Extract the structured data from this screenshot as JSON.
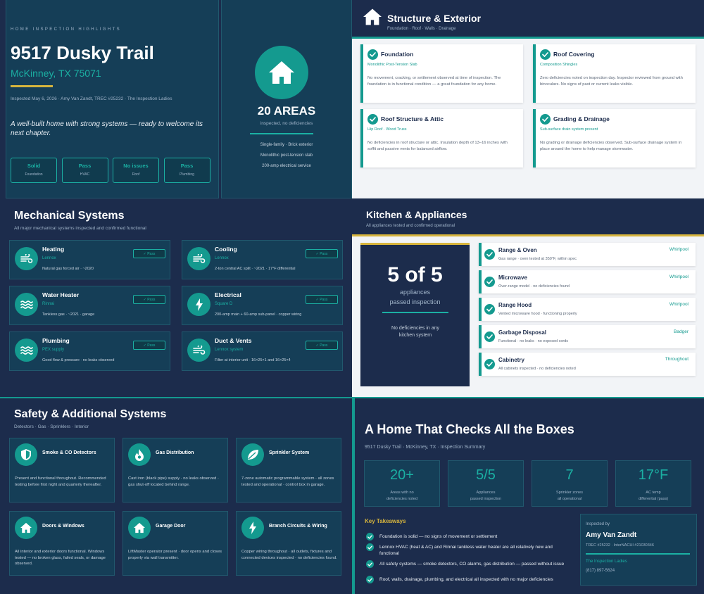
{
  "hero": {
    "eyebrow": "HOME INSPECTION HIGHLIGHTS",
    "address": "9517 Dusky Trail",
    "city": "McKinney, TX 75071",
    "meta": "Inspected May 6, 2026  ·  Amy Van Zandt, TREC #25232  ·  The Inspection Ladies",
    "tagline": "A well-built home with strong systems — ready to welcome its next chapter.",
    "stats": [
      {
        "value": "Solid",
        "label": "Foundation"
      },
      {
        "value": "Pass",
        "label": "HVAC"
      },
      {
        "value": "No issues",
        "label": "Roof"
      },
      {
        "value": "Pass",
        "label": "Plumbing"
      }
    ],
    "big_number": "20 AREAS",
    "big_sub": "inspected, no deficiencies",
    "facts": [
      "Single-family · Brick exterior",
      "Monolithic post-tension slab",
      "200-amp electrical service"
    ]
  },
  "structure": {
    "title": "Structure & Exterior",
    "subtitle": "Foundation · Roof · Walls · Drainage",
    "cards": [
      {
        "title": "Foundation",
        "sub": "Monolithic Post-Tension Slab",
        "body": "No movement, cracking, or settlement observed at time of inspection. The foundation is in functional condition — a great foundation for any home."
      },
      {
        "title": "Roof Covering",
        "sub": "Composition Shingles",
        "body": "Zero deficiencies noted on inspection day. Inspector reviewed from ground with binoculars. No signs of past or current leaks visible."
      },
      {
        "title": "Roof Structure & Attic",
        "sub": "Hip Roof · Wood Truss",
        "body": "No deficiencies in roof structure or attic. Insulation depth of 13–16 inches with soffit and passive vents for balanced airflow."
      },
      {
        "title": "Grading & Drainage",
        "sub": "Sub-surface drain system present",
        "body": "No grading or drainage deficiencies observed. Sub-surface drainage system in place around the home to help manage stormwater."
      }
    ]
  },
  "mechanical": {
    "title": "Mechanical Systems",
    "subtitle": "All major mechanical systems inspected and confirmed functional",
    "pass_label": "✓ Pass",
    "items": [
      {
        "title": "Heating",
        "brand": "Lennox",
        "desc": "Natural gas forced air · ~2020",
        "icon": "wind-icon"
      },
      {
        "title": "Cooling",
        "brand": "Lennox",
        "desc": "2-ton central AC split · ~2021 · 17°F differential",
        "icon": "wind-icon"
      },
      {
        "title": "Water Heater",
        "brand": "Rinnai",
        "desc": "Tankless gas · ~2021 · garage",
        "icon": "water-icon"
      },
      {
        "title": "Electrical",
        "brand": "Square D",
        "desc": "200-amp main + 60-amp sub-panel · copper wiring",
        "icon": "bolt-icon"
      },
      {
        "title": "Plumbing",
        "brand": "PEX supply",
        "desc": "Good flow & pressure · no leaks observed",
        "icon": "water-icon"
      },
      {
        "title": "Duct & Vents",
        "brand": "Lennox system",
        "desc": "Filter at interior unit · 16×25×1 and 16×25×4",
        "icon": "wind-icon"
      }
    ]
  },
  "kitchen": {
    "title": "Kitchen & Appliances",
    "subtitle": "All appliances tested and confirmed operational",
    "big": "5 of 5",
    "big_l1": "appliances",
    "big_l2": "passed inspection",
    "note": "No deficiencies in any kitchen system",
    "items": [
      {
        "title": "Range & Oven",
        "desc": "Gas range · oven tested at 350°F, within spec",
        "brand": "Whirlpool"
      },
      {
        "title": "Microwave",
        "desc": "Over-range model · no deficiencies found",
        "brand": "Whirlpool"
      },
      {
        "title": "Range Hood",
        "desc": "Vented microwave hood · functioning properly",
        "brand": "Whirlpool"
      },
      {
        "title": "Garbage Disposal",
        "desc": "Functional · no leaks · no exposed cords",
        "brand": "Badger"
      },
      {
        "title": "Cabinetry",
        "desc": "All cabinets inspected · no deficiencies noted",
        "brand": "Throughout"
      }
    ]
  },
  "safety": {
    "title": "Safety & Additional Systems",
    "subtitle": "Detectors · Gas · Sprinklers · Interior",
    "items": [
      {
        "title": "Smoke & CO Detectors",
        "body": "Present and functional throughout. Recommended testing before first night and quarterly thereafter.",
        "icon": "shield-icon"
      },
      {
        "title": "Gas Distribution",
        "body": "Cast iron (black pipe) supply · no leaks observed · gas shut-off located behind range.",
        "icon": "flame-icon"
      },
      {
        "title": "Sprinkler System",
        "body": "7-zone automatic programmable system · all zones tested and operational · control box in garage.",
        "icon": "leaf-icon"
      },
      {
        "title": "Doors & Windows",
        "body": "All interior and exterior doors functional. Windows tested — no broken glass, failed seals, or damage observed.",
        "icon": "home-icon"
      },
      {
        "title": "Garage Door",
        "body": "LiftMaster operator present · door opens and closes properly via wall transmitter.",
        "icon": "home-icon"
      },
      {
        "title": "Branch Circuits & Wiring",
        "body": "Copper wiring throughout · all outlets, fixtures and connected devices inspected · no deficiencies found.",
        "icon": "bolt-icon"
      }
    ]
  },
  "summary": {
    "title": "A Home That Checks All the Boxes",
    "subtitle": "9517 Dusky Trail · McKinney, TX · Inspection Summary",
    "stats": [
      {
        "value": "20+",
        "l1": "Areas with no",
        "l2": "deficiencies noted"
      },
      {
        "value": "5/5",
        "l1": "Appliances",
        "l2": "passed inspection"
      },
      {
        "value": "7",
        "l1": "Sprinkler zones",
        "l2": "all operational"
      },
      {
        "value": "17°F",
        "l1": "AC temp",
        "l2": "differential (pass)"
      }
    ],
    "takeaways_title": "Key Takeaways",
    "takeaways": [
      "Foundation is solid — no signs of movement or settlement",
      "Lennox HVAC (heat & AC) and Rinnai tankless water heater are all relatively new and functional",
      "All safety systems — smoke detectors, CO alarms, gas distribution — passed without issue",
      "Roof, walls, drainage, plumbing, and electrical all inspected with no major deficiencies"
    ],
    "inspector_label": "Inspected by",
    "inspector_name": "Amy Van Zandt",
    "inspector_ids": "TREC #25232 · InterNACHI #21030346",
    "inspector_company": "The Inspection Ladies",
    "inspector_phone": "(817) 897-5624"
  }
}
